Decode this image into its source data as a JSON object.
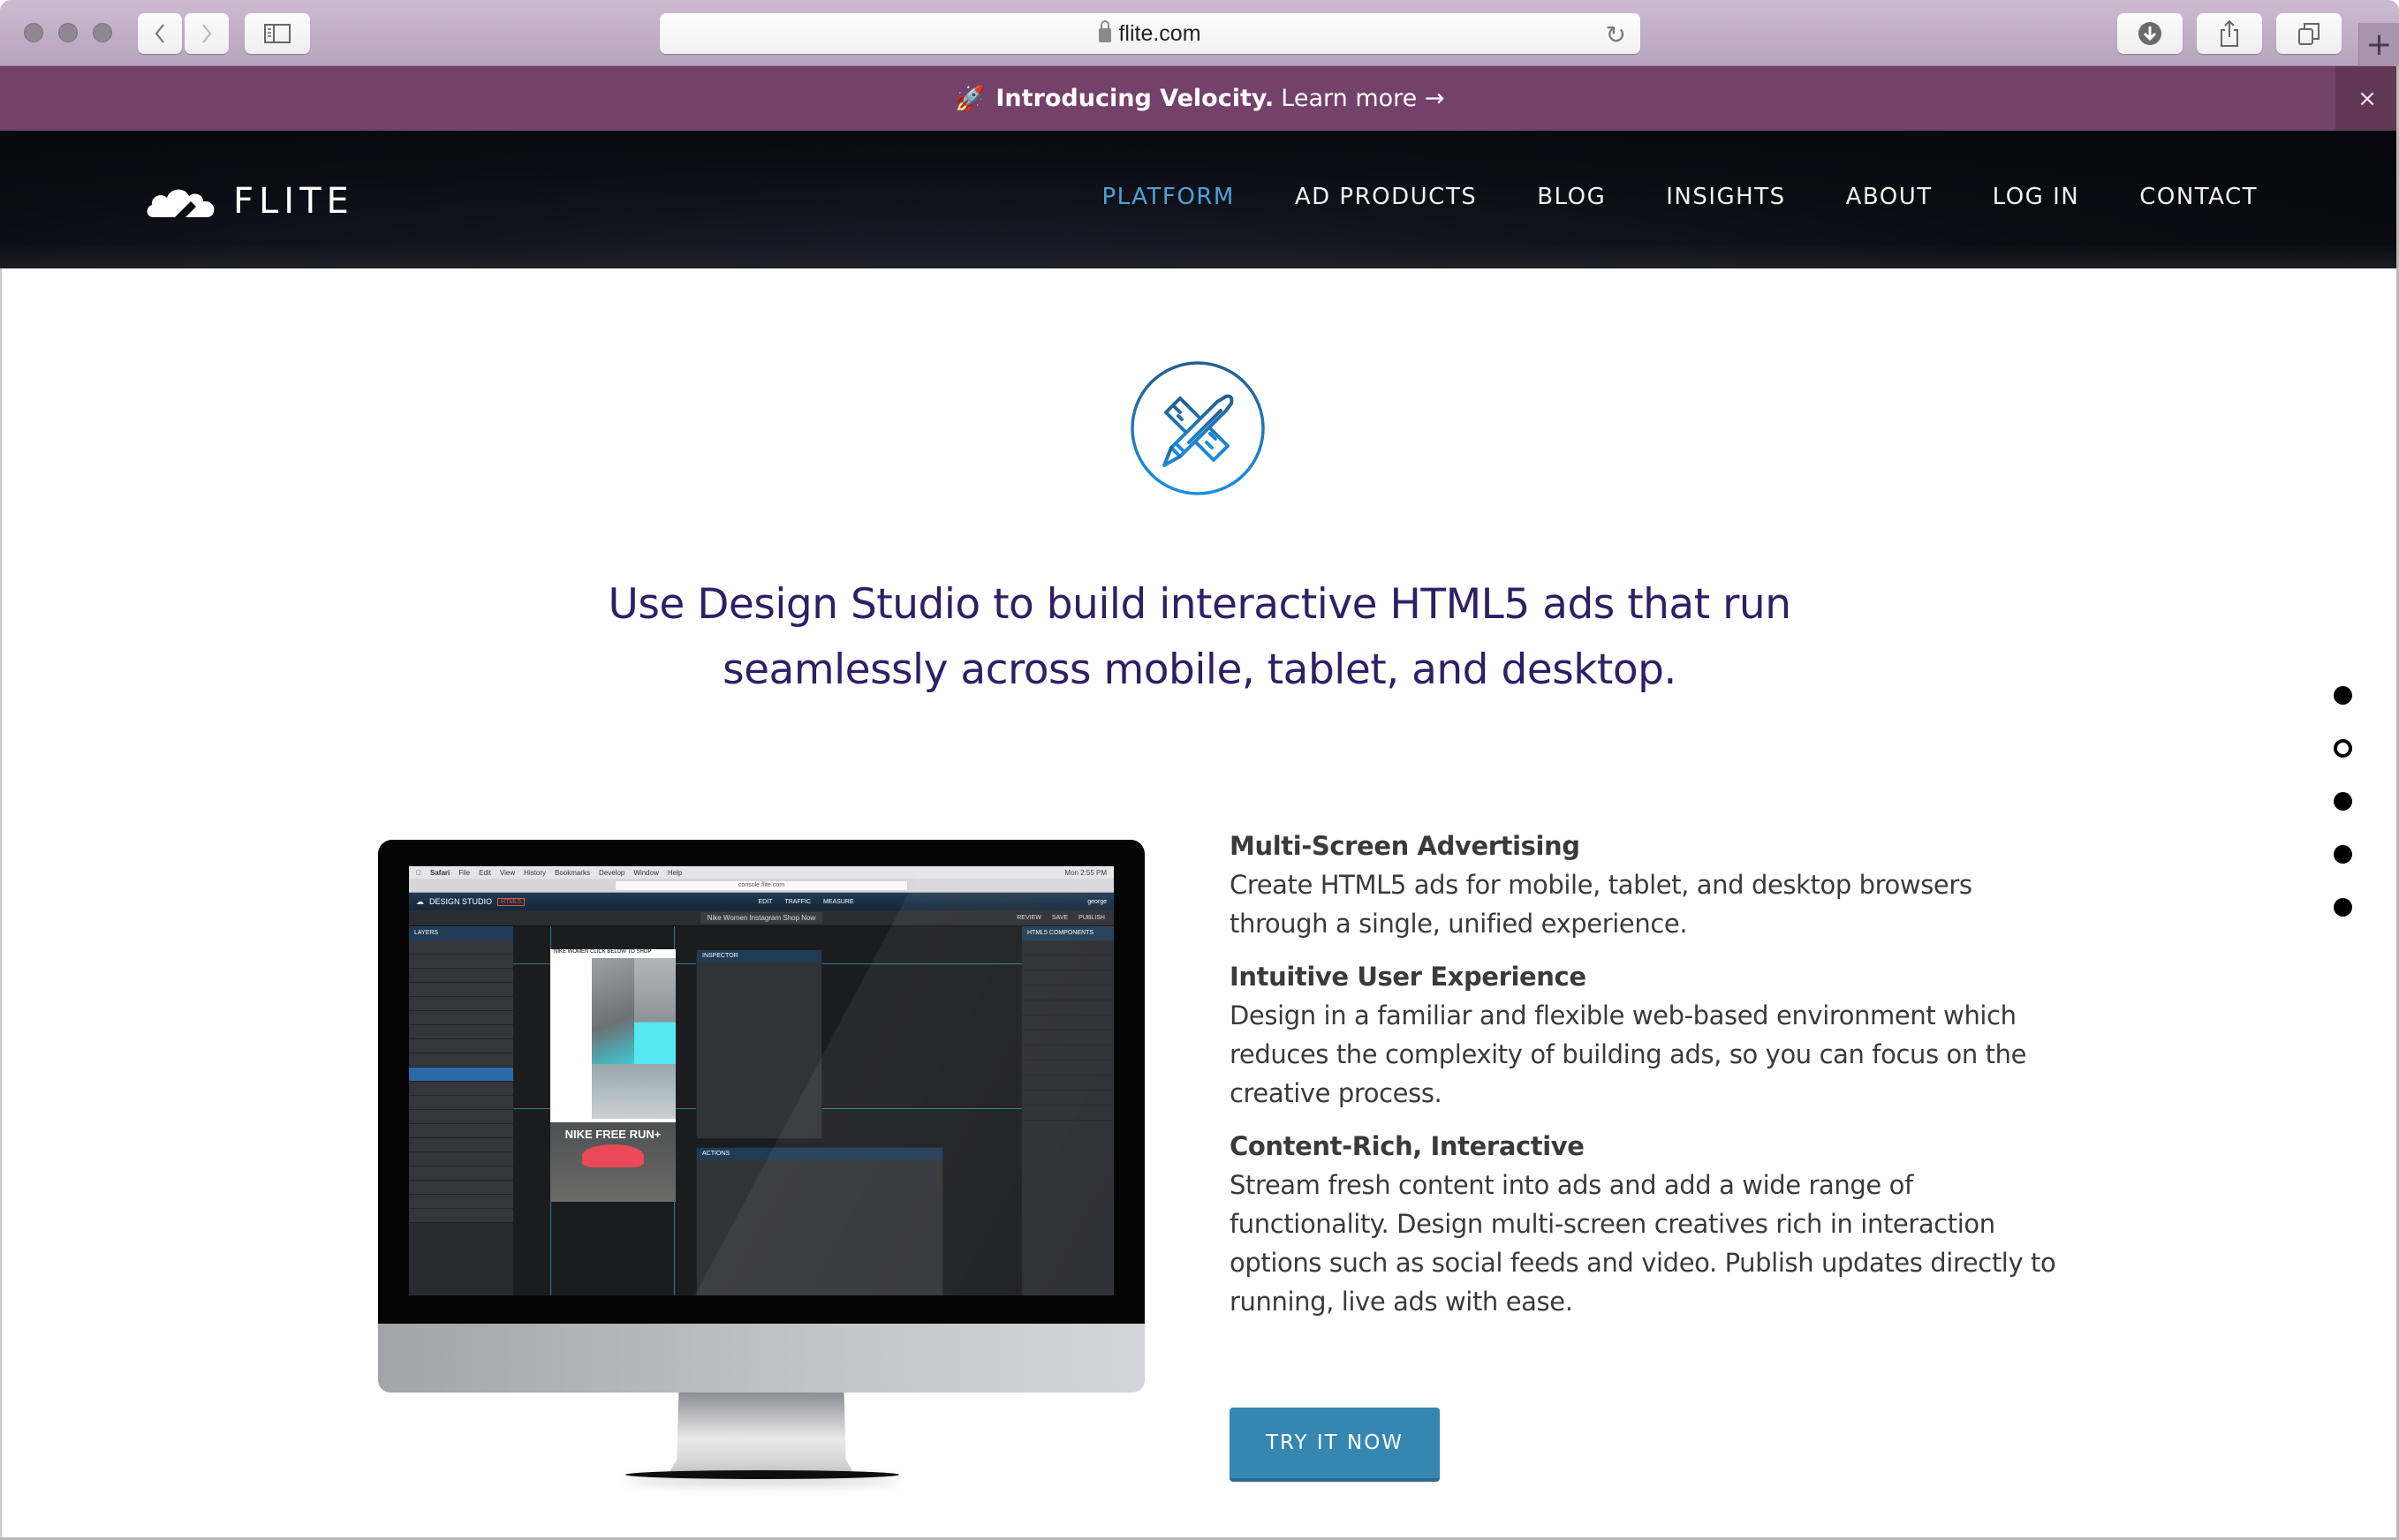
{
  "browser": {
    "url": "flite.com",
    "icons": {
      "back": "chevron-left-icon",
      "forward": "chevron-right-icon",
      "sidebar": "sidebar-icon",
      "reload": "reload-icon",
      "downloads": "download-icon",
      "share": "share-icon",
      "tabs": "tabs-icon",
      "new_tab": "plus-icon"
    }
  },
  "banner": {
    "icon": "rocket-icon",
    "bold_text": "Introducing Velocity.",
    "link_text": "Learn more →",
    "close_label": "×",
    "background_color": "#74416a"
  },
  "nav": {
    "logo_text": "FLITE",
    "links": [
      {
        "label": "PLATFORM",
        "active": true
      },
      {
        "label": "AD PRODUCTS",
        "active": false
      },
      {
        "label": "BLOG",
        "active": false
      },
      {
        "label": "INSIGHTS",
        "active": false
      },
      {
        "label": "ABOUT",
        "active": false
      },
      {
        "label": "LOG IN",
        "active": false
      },
      {
        "label": "CONTACT",
        "active": false
      }
    ],
    "active_color": "#4aa3da"
  },
  "hero": {
    "icon": "pencil-ruler-icon",
    "headline_line1": "Use Design Studio to build interactive HTML5 ads that run",
    "headline_line2": "seamlessly across mobile, tablet, and desktop.",
    "headline_color": "#2e1f66"
  },
  "screenshot": {
    "menu": [
      "Safari",
      "File",
      "Edit",
      "View",
      "History",
      "Bookmarks",
      "Develop",
      "Window",
      "Help"
    ],
    "clock": "Mon 2:55 PM",
    "inner_url": "console.flite.com",
    "app_title": "DESIGN STUDIO",
    "app_badge": "HTML5",
    "modes": [
      "EDIT",
      "TRAFFIC",
      "MEASURE"
    ],
    "document_name": "Nike Women Instagram Shop Now",
    "toolbar_actions": [
      "REVIEW",
      "SAVE",
      "PUBLISH"
    ],
    "user": "george",
    "layers_title": "LAYERS",
    "components_title": "HTML5 COMPONENTS",
    "inspector_title": "INSPECTOR",
    "actions_title": "ACTIONS",
    "ad_header": "NIKE WOMEN  CLICK BELOW TO SHOP",
    "ad_tagline": "NIKE FREE RUN+"
  },
  "features": [
    {
      "title": "Multi-Screen Advertising",
      "body": "Create HTML5 ads for mobile, tablet, and desktop browsers through a single, unified experience."
    },
    {
      "title": "Intuitive User Experience",
      "body": "Design in a familiar and flexible web-based environment which reduces the complexity of building ads, so you can focus on the creative process."
    },
    {
      "title": "Content-Rich, Interactive",
      "body": "Stream fresh content into ads and add a wide range of functionality. Design multi-screen creatives rich in interaction options such as social feeds and video. Publish updates directly to running, live ads with ease."
    }
  ],
  "cta": {
    "label": "TRY IT NOW",
    "color": "#3587b2"
  },
  "pagination": {
    "total": 5,
    "active_index": 1
  }
}
